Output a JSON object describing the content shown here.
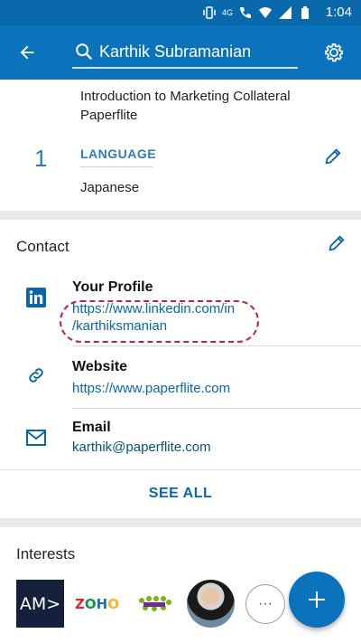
{
  "status_bar": {
    "time": "1:04",
    "network": "4G"
  },
  "search": {
    "value": "Karthik Subramanian"
  },
  "language_card": {
    "course": "Introduction to Marketing Collateral Paperflite",
    "number": "1",
    "title": "LANGUAGE",
    "value": "Japanese"
  },
  "contact": {
    "title": "Contact",
    "profile_label": "Your Profile",
    "profile_url_line1": "https://www.linkedin.com/in",
    "profile_url_line2": "/karthiksmanian",
    "website_label": "Website",
    "website_url": "https://www.paperflite.com",
    "email_label": "Email",
    "email_value": "karthik@paperflite.com",
    "see_all": "SEE ALL"
  },
  "interests": {
    "title": "Interests",
    "items": [
      {
        "name": "AMD",
        "text": "AM>"
      },
      {
        "name": "Zoho",
        "text": "ZOHO"
      },
      {
        "name": "group-logo"
      },
      {
        "name": "person-avatar"
      }
    ],
    "more_label": "···"
  },
  "colors": {
    "primary": "#0a73bb",
    "link": "#0a66a8",
    "highlight": "#c8195a"
  }
}
